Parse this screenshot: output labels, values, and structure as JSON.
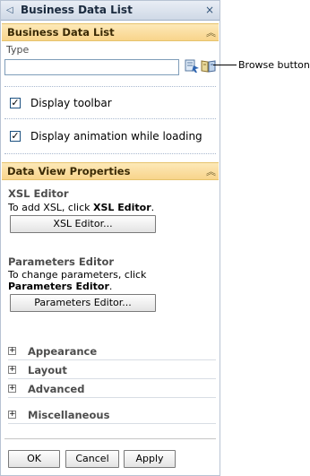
{
  "panel": {
    "title": "Business Data List",
    "collapse_icon": "chevron-left-icon",
    "close_glyph": "×"
  },
  "section1": {
    "header": "Business Data List",
    "type_label": "Type",
    "type_value": "",
    "display_toolbar_label": "Display toolbar",
    "display_toolbar_checked": true,
    "display_animation_label": "Display animation while loading",
    "display_animation_checked": true
  },
  "section2": {
    "header": "Data View Properties",
    "xsl": {
      "title": "XSL Editor",
      "desc_prefix": "To add XSL, click ",
      "desc_bold": "XSL Editor",
      "desc_suffix": ".",
      "button": "XSL Editor..."
    },
    "params": {
      "title": "Parameters Editor",
      "desc_line1": "To change parameters, click",
      "desc_bold": "Parameters Editor",
      "desc_suffix": ".",
      "button": "Parameters Editor..."
    },
    "groups": [
      "Appearance",
      "Layout",
      "Advanced",
      "Miscellaneous"
    ]
  },
  "footer": {
    "ok": "OK",
    "cancel": "Cancel",
    "apply": "Apply"
  },
  "callout": {
    "label": "Browse button"
  },
  "colors": {
    "section_header_bg": "#f8d48b",
    "title_bar_bg": "#cfd9e6",
    "border": "#b8c3d3"
  }
}
